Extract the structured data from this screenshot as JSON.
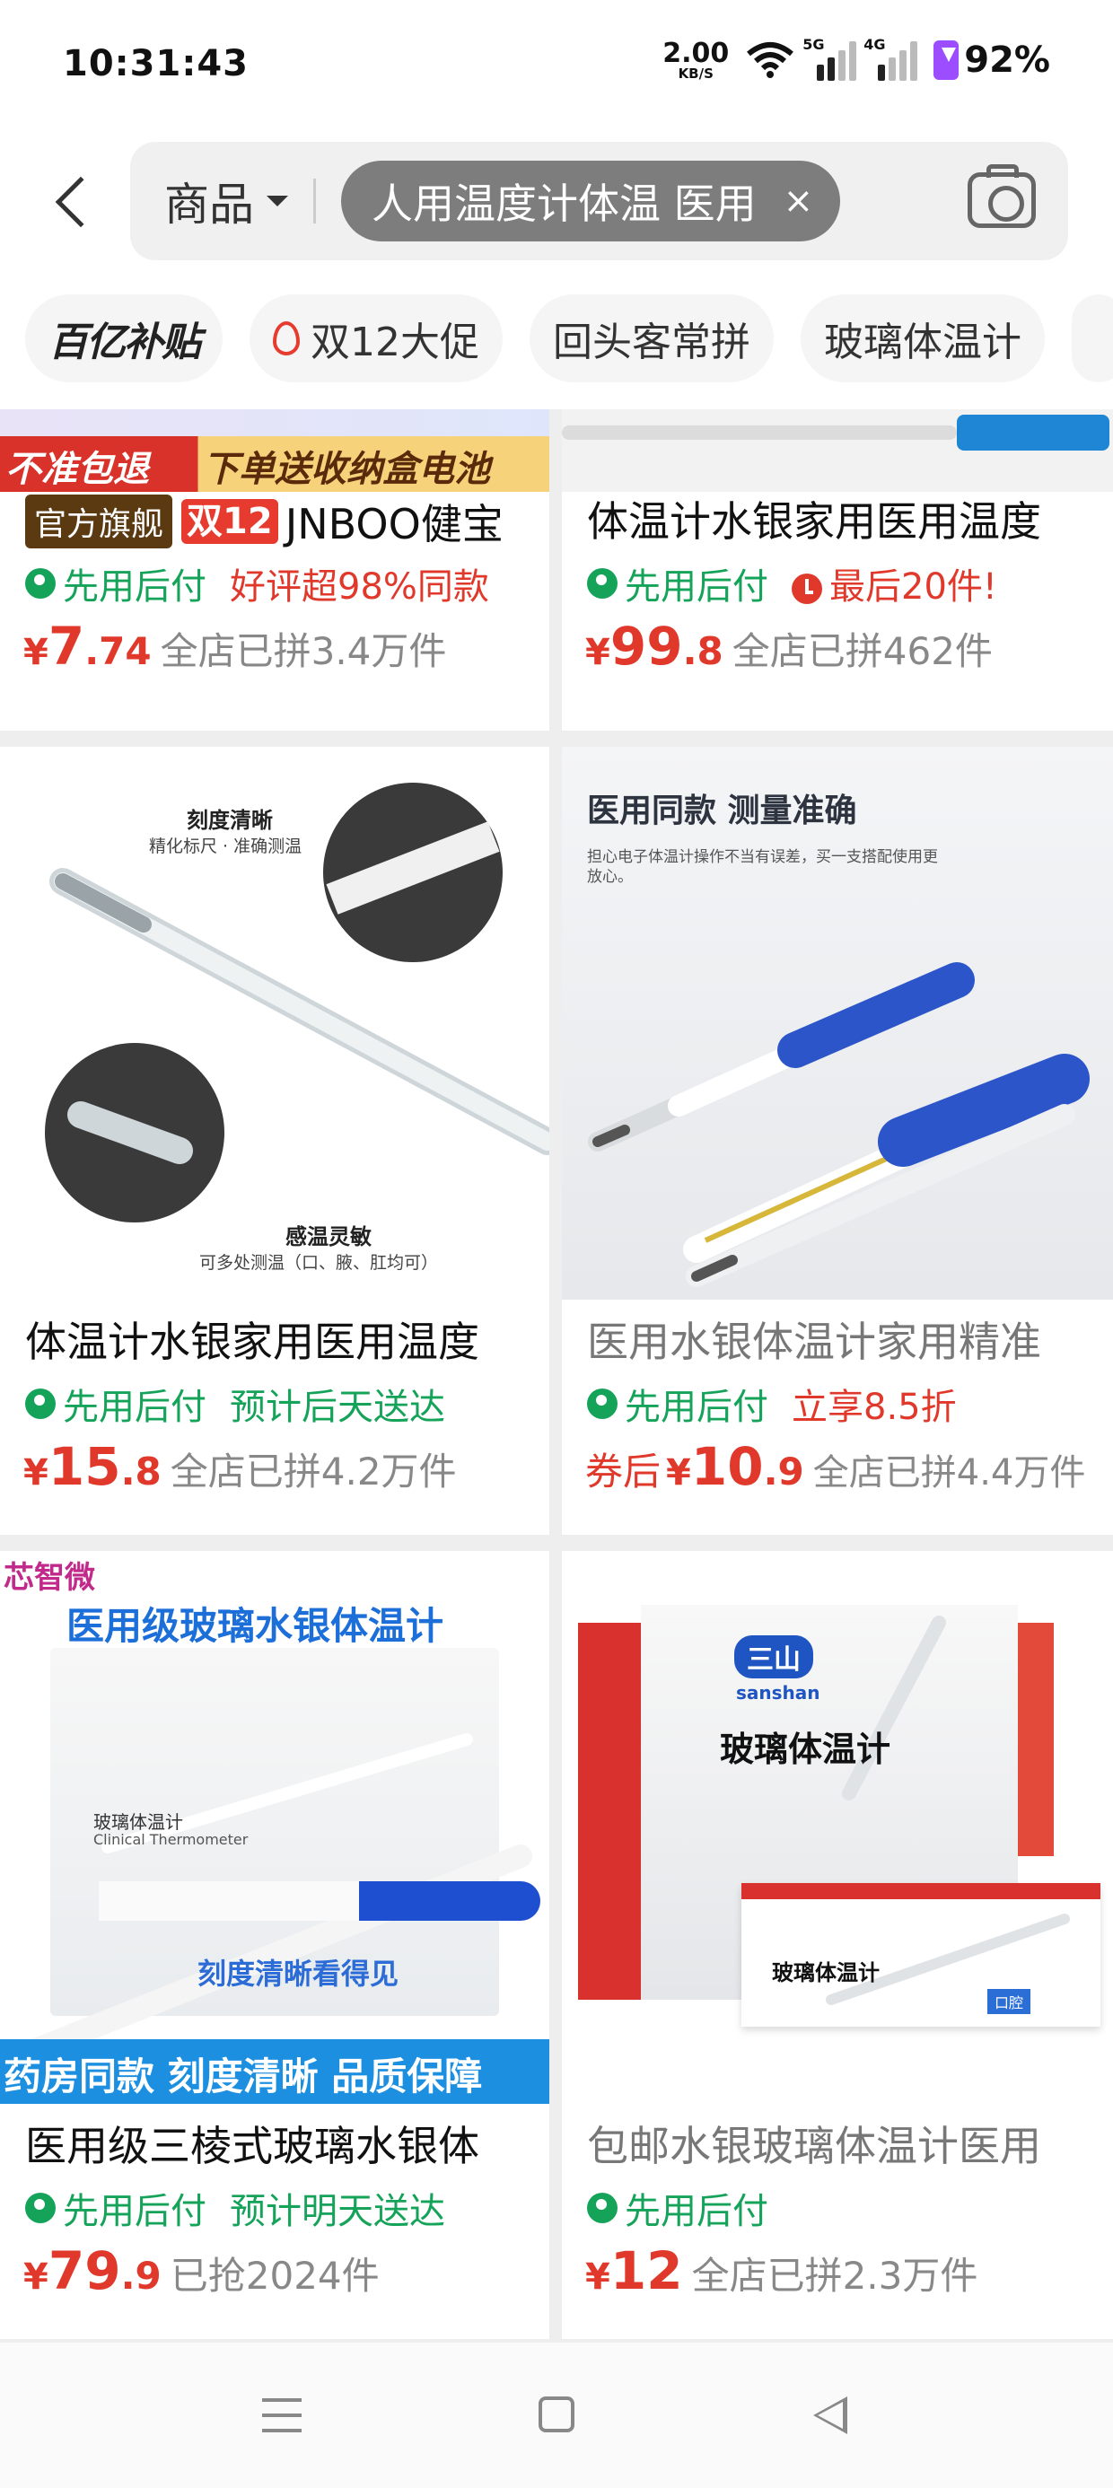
{
  "status": {
    "time": "10:31:43",
    "speed_value": "2.00",
    "speed_unit": "KB/S",
    "net1": "5G",
    "net2": "4G",
    "battery": "92%"
  },
  "search": {
    "category": "商品",
    "query": "人用温度计体温 医用",
    "clear": "×"
  },
  "filters": [
    {
      "label": "百亿补贴"
    },
    {
      "label": "双12大促"
    },
    {
      "label": "回头客常拼"
    },
    {
      "label": "玻璃体温计"
    }
  ],
  "products": [
    {
      "banner_left": "不准包退",
      "banner_right": "下单送收纳盒电池",
      "badge_flag": "官方旗舰",
      "badge_12": "双12",
      "title": "JNBOO健宝",
      "pay": "先用后付",
      "tag": "好评超98%同款",
      "price_yen": "¥",
      "price_int": "7",
      "price_dec": ".74",
      "sold": "全店已拼3.4万件"
    },
    {
      "title": "体温计水银家用医用温度",
      "pay": "先用后付",
      "tag": "最后20件!",
      "price_yen": "¥",
      "price_int": "99",
      "price_dec": ".8",
      "sold": "全店已拼462件"
    },
    {
      "img_text1": "刻度清晰",
      "img_text2": "精化标尺 · 准确测温",
      "img_text3": "感温灵敏",
      "img_text4": "可多处测温（口、腋、肛均可）",
      "title": "体温计水银家用医用温度",
      "pay": "先用后付",
      "tag": "预计后天送达",
      "price_yen": "¥",
      "price_int": "15",
      "price_dec": ".8",
      "sold": "全店已拼4.2万件"
    },
    {
      "img_text1": "医用同款 测量准确",
      "img_text2": "担心电子体温计操作不当有误差，买一支搭配使用更放心。",
      "title": "医用水银体温计家用精准",
      "pay": "先用后付",
      "tag": "立享8.5折",
      "coupon": "券后",
      "price_yen": "¥",
      "price_int": "10",
      "price_dec": ".9",
      "sold": "全店已拼4.4万件"
    },
    {
      "img_brand": "芯智微",
      "img_head": "医用级玻璃水银体温计",
      "img_text1": "玻璃体温计",
      "img_text2": "Clinical Thermometer",
      "img_text3": "刻度清晰看得见",
      "img_footer": "药房同款 刻度清晰 品质保障",
      "title": "医用级三棱式玻璃水银体",
      "pay": "先用后付",
      "tag": "预计明天送达",
      "price_yen": "¥",
      "price_int": "79",
      "price_dec": ".9",
      "sold": "已抢2024件"
    },
    {
      "img_logo": "三山",
      "img_en": "sanshan",
      "img_text1": "玻璃体温计",
      "img_text2": "玻璃体温计",
      "img_text3": "口腔",
      "title": "包邮水银玻璃体温计医用",
      "pay": "先用后付",
      "price_yen": "¥",
      "price_int": "12",
      "price_dec": "",
      "sold": "全店已拼2.3万件"
    }
  ]
}
